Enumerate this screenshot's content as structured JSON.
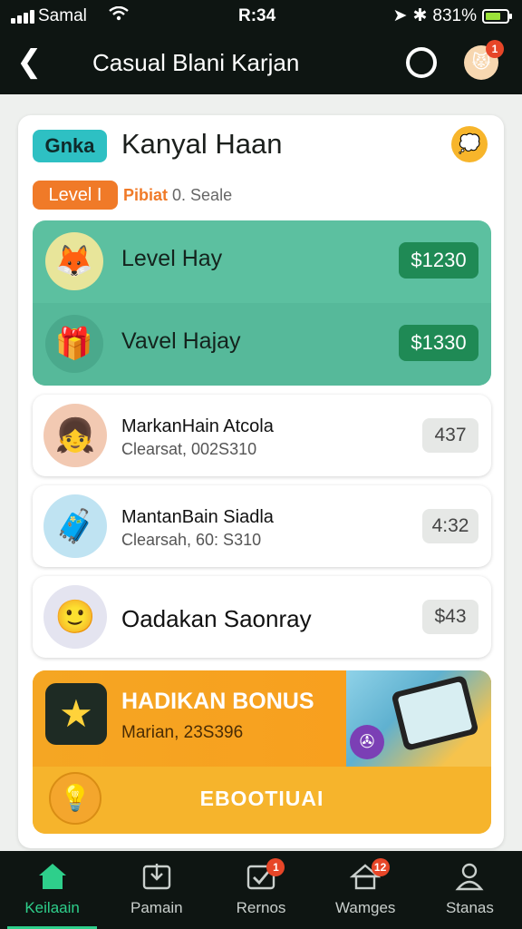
{
  "status_bar": {
    "carrier": "Samal",
    "time": "R:34",
    "battery": "831%"
  },
  "app_bar": {
    "title": "Casual Blani Karjan",
    "avatar_badge": "1"
  },
  "card": {
    "tag": "Gnka",
    "title": "Kanyal Haan",
    "level_pill": "Level I",
    "level_highlight": "Pibiat",
    "level_sub": "0. Seale"
  },
  "featured": [
    {
      "label": "Level Hay",
      "price": "$1230",
      "icon": "fox-icon"
    },
    {
      "label": "Vavel Hajay",
      "price": "$1330",
      "icon": "chest-icon"
    }
  ],
  "list": [
    {
      "title": "MarkanHain Atcola",
      "subtitle": "Clearsat, 002S310",
      "value": "437",
      "icon": "girl-avatar-icon"
    },
    {
      "title": "MantanBain Siadla",
      "subtitle": "Clearsah, 60: S310",
      "value": "4:32",
      "icon": "machine-icon"
    },
    {
      "title": "Oadakan Saonray",
      "value": "$43",
      "icon": "sketch-face-icon"
    }
  ],
  "bonus": {
    "heading": "HADIKAN BONUS",
    "subtitle": "Marian, 23S396",
    "cta": "EBOOTIUAI"
  },
  "nav": [
    {
      "label": "Keilaain",
      "icon": "home-icon",
      "active": true
    },
    {
      "label": "Pamain",
      "icon": "download-box-icon"
    },
    {
      "label": "Rernos",
      "icon": "check-box-icon",
      "badge": "1"
    },
    {
      "label": "Wamges",
      "icon": "house-stack-icon",
      "badge": "12"
    },
    {
      "label": "Stanas",
      "icon": "person-icon"
    }
  ],
  "colors": {
    "accent": "#2ecf8b",
    "teal": "#5cc0a0",
    "orange": "#f07a28",
    "bonus": "#f7b328",
    "dark": "#0e1512"
  }
}
